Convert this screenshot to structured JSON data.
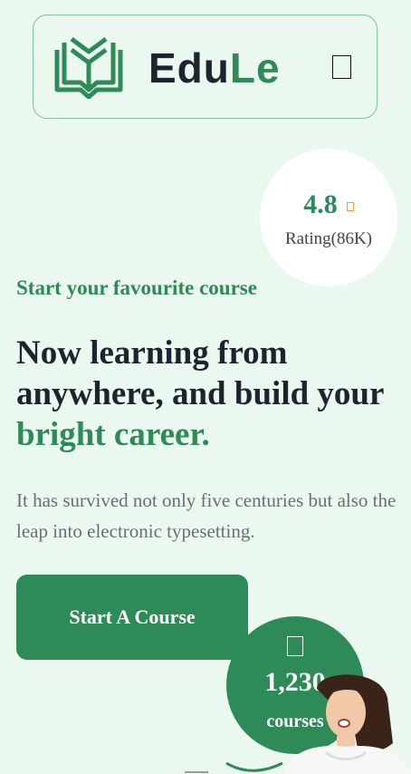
{
  "header": {
    "logo_text_part1": "Edu",
    "logo_text_part2": "Le",
    "logo_alt": "EduLe"
  },
  "rating": {
    "value": "4.8",
    "label": "Rating(86K)",
    "star_icon": "star-icon"
  },
  "hero": {
    "eyebrow": "Start your favourite course",
    "headline_line1": "Now learning from",
    "headline_line2": "anywhere, and build your",
    "headline_highlight": "bright career.",
    "description": "It has survived not only five centuries but also the leap into electronic typesetting.",
    "cta_label": "Start A Course"
  },
  "courses_badge": {
    "count": "1,230",
    "label": "courses",
    "icon": "book-icon"
  },
  "colors": {
    "brand_green": "#2e8b57",
    "background": "#eaf8ef",
    "text_dark": "#1e2330",
    "text_muted": "#6b6f73"
  }
}
